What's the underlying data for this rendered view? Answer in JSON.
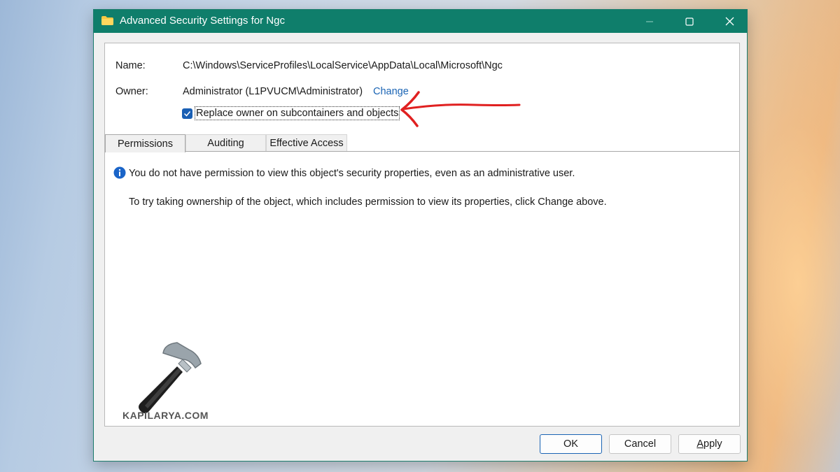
{
  "window": {
    "title": "Advanced Security Settings for Ngc"
  },
  "fields": {
    "name_label": "Name:",
    "name_value": "C:\\Windows\\ServiceProfiles\\LocalService\\AppData\\Local\\Microsoft\\Ngc",
    "owner_label": "Owner:",
    "owner_value": "Administrator (L1PVUCM\\Administrator)",
    "change_link": "Change",
    "replace_owner_label": "Replace owner on subcontainers and objects",
    "replace_owner_checked": true
  },
  "tabs": [
    {
      "label": "Permissions",
      "active": true
    },
    {
      "label": "Auditing",
      "active": false
    },
    {
      "label": "Effective Access",
      "active": false
    }
  ],
  "content": {
    "info_message": "You do not have permission to view this object's security properties, even as an administrative user.",
    "hint_message": "To try taking ownership of the object, which includes permission to view its properties, click Change above."
  },
  "watermark": {
    "text": "KAPILARYA.COM"
  },
  "buttons": {
    "ok": "OK",
    "cancel": "Cancel",
    "apply_first": "A",
    "apply_rest": "pply"
  },
  "colors": {
    "titlebar": "#0f7e6b",
    "link": "#1a64b4",
    "checkbox": "#1a5fb4",
    "annotation_arrow": "#e02020"
  },
  "icons": {
    "title": "folder-icon",
    "info": "info-icon",
    "annotation": "red-arrow-annotation"
  }
}
